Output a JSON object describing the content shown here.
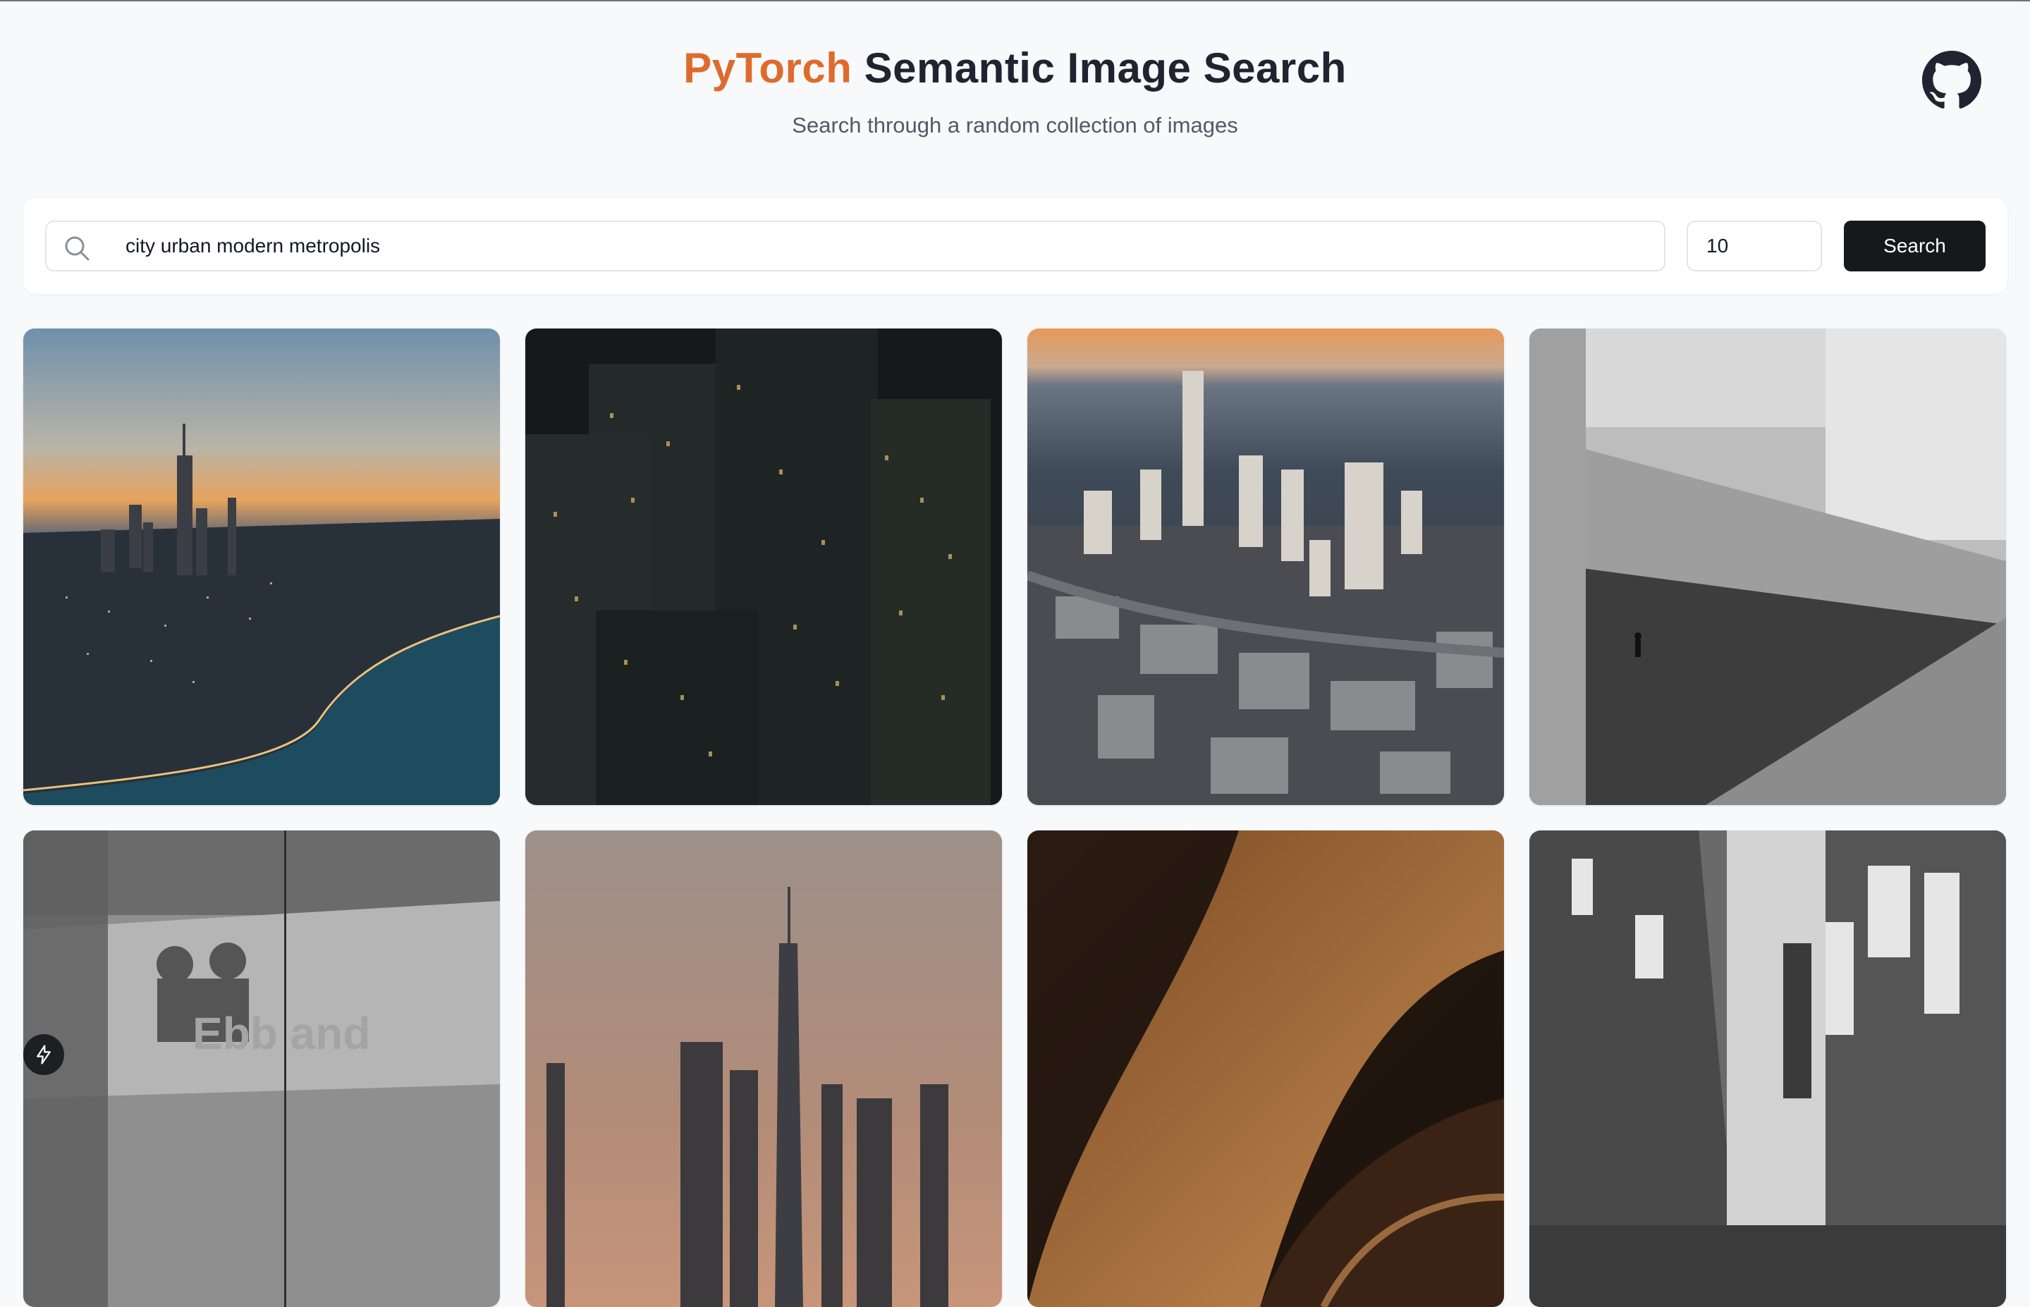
{
  "header": {
    "title_brand": "PyTorch",
    "title_rest": "Semantic Image Search",
    "subtitle": "Search through a random collection of images"
  },
  "icons": {
    "github": "github-icon",
    "search": "search-icon",
    "badge": "lightning-bolt-icon"
  },
  "search": {
    "query": "city urban modern metropolis",
    "count": "10",
    "button_label": "Search"
  },
  "colors": {
    "brand": "#de6b2c",
    "title": "#1f2430",
    "button": "#17181c",
    "background": "#f8f9fb"
  },
  "results": [
    {
      "description": "aerial city skyline at sunset by a lake"
    },
    {
      "description": "dark skyscrapers with lit windows at night"
    },
    {
      "description": "aerial downtown at golden hour by the bay"
    },
    {
      "description": "black and white concrete architecture with a walking figure"
    },
    {
      "description": "black and white motion blur of people in front of a wall with text"
    },
    {
      "description": "single tall tower against a dusk sky"
    },
    {
      "description": "abstract brown curved surfaces"
    },
    {
      "description": "black and white narrow street with signs"
    }
  ]
}
